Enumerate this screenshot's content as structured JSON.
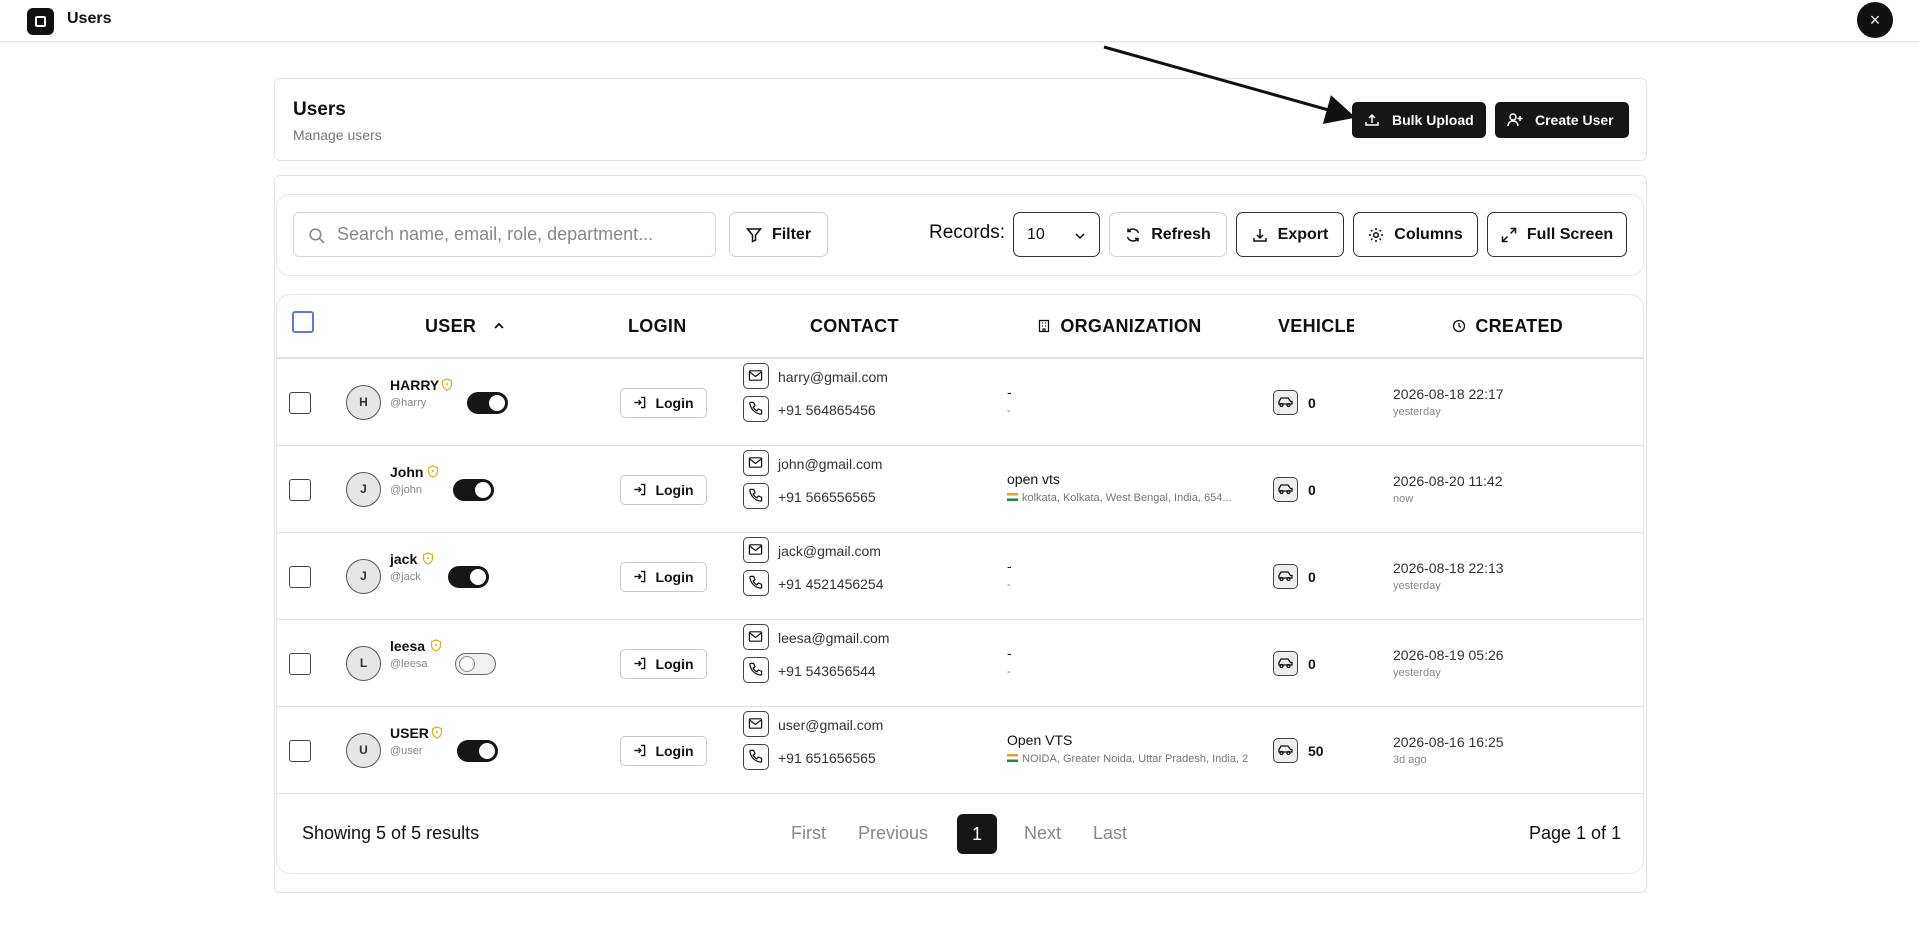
{
  "window": {
    "title": "Users",
    "close_label": "×"
  },
  "header": {
    "title": "Users",
    "subtitle": "Manage users",
    "bulk_upload_label": "Bulk Upload",
    "create_user_label": "Create User"
  },
  "toolbar": {
    "search_placeholder": "Search name, email, role, department...",
    "filter_label": "Filter",
    "records_label": "Records:",
    "records_value": "10",
    "refresh_label": "Refresh",
    "export_label": "Export",
    "columns_label": "Columns",
    "fullscreen_label": "Full Screen"
  },
  "table": {
    "columns": [
      "USER",
      "LOGIN",
      "CONTACT",
      "ORGANIZATION",
      "VEHICLE",
      "CREATED"
    ],
    "login_label": "Login",
    "rows": [
      {
        "initial": "H",
        "name": "HARRY",
        "handle": "@harry",
        "active": true,
        "email": "harry@gmail.com",
        "phone": "+91 564865456",
        "org": "-",
        "org_addr": "-",
        "vehicles": "0",
        "created": "2026-08-18 22:17",
        "created_rel": "yesterday"
      },
      {
        "initial": "J",
        "name": "John",
        "handle": "@john",
        "active": true,
        "email": "john@gmail.com",
        "phone": "+91 566556565",
        "org": "open vts",
        "org_addr": "kolkata, Kolkata, West Bengal, India, 654...",
        "vehicles": "0",
        "created": "2026-08-20 11:42",
        "created_rel": "now"
      },
      {
        "initial": "J",
        "name": "jack",
        "handle": "@jack",
        "active": true,
        "email": "jack@gmail.com",
        "phone": "+91 4521456254",
        "org": "-",
        "org_addr": "-",
        "vehicles": "0",
        "created": "2026-08-18 22:13",
        "created_rel": "yesterday"
      },
      {
        "initial": "L",
        "name": "leesa",
        "handle": "@leesa",
        "active": false,
        "email": "leesa@gmail.com",
        "phone": "+91 543656544",
        "org": "-",
        "org_addr": "-",
        "vehicles": "0",
        "created": "2026-08-19 05:26",
        "created_rel": "yesterday"
      },
      {
        "initial": "U",
        "name": "USER",
        "handle": "@user",
        "active": true,
        "email": "user@gmail.com",
        "phone": "+91 651656565",
        "org": "Open VTS",
        "org_addr": "NOIDA, Greater Noida, Uttar Pradesh, India, 2",
        "vehicles": "50",
        "created": "2026-08-16 16:25",
        "created_rel": "3d ago"
      }
    ]
  },
  "footer": {
    "showing": "Showing 5 of 5 results",
    "first": "First",
    "previous": "Previous",
    "current_page": "1",
    "next": "Next",
    "last": "Last",
    "page_of": "Page 1 of 1"
  },
  "icons": {
    "upload": "upload-icon",
    "user_plus": "user-plus-icon",
    "search": "search-icon",
    "filter": "filter-icon",
    "refresh": "refresh-icon",
    "download": "download-icon",
    "gear": "gear-icon",
    "expand": "expand-icon",
    "mail": "mail-icon",
    "phone": "phone-icon",
    "car": "car-icon",
    "building": "building-icon",
    "clock": "clock-icon",
    "shield": "shield-icon",
    "login": "login-icon"
  },
  "colors": {
    "accent": "#161616",
    "shield": "#e0b020",
    "checkbox_focus": "#5b7bd5"
  }
}
